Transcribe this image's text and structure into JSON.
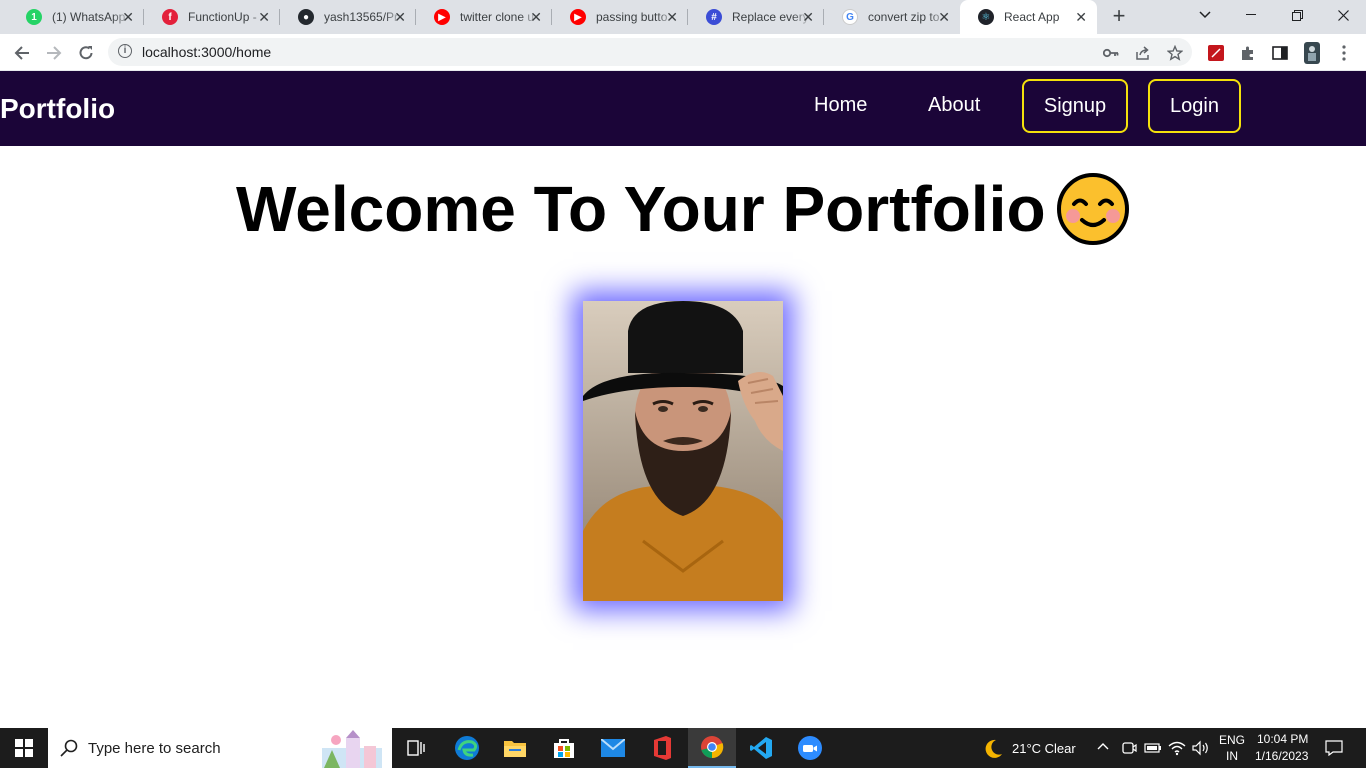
{
  "browser": {
    "tabs": [
      {
        "title": "(1) WhatsApp",
        "icon": "whatsapp-icon",
        "color": "#25d366",
        "glyph": "1"
      },
      {
        "title": "FunctionUp - ",
        "icon": "functionup-icon",
        "color": "#e3203b",
        "glyph": "f"
      },
      {
        "title": "yash13565/Pr",
        "icon": "github-icon",
        "color": "#24292f",
        "glyph": "●"
      },
      {
        "title": "twitter clone u",
        "icon": "youtube-icon",
        "color": "#ff0000",
        "glyph": "▶"
      },
      {
        "title": "passing butto",
        "icon": "youtube-icon",
        "color": "#ff0000",
        "glyph": "▶"
      },
      {
        "title": "Replace every",
        "icon": "geeks-icon",
        "color": "#3b4dd6",
        "glyph": "#"
      },
      {
        "title": "convert zip to",
        "icon": "google-icon",
        "color": "#4285f4",
        "glyph": "G"
      },
      {
        "title": "React App",
        "icon": "react-icon",
        "color": "#61dafb",
        "glyph": "⚛"
      }
    ],
    "url": "localhost:3000/home"
  },
  "page": {
    "brand": "Portfolio",
    "nav": {
      "home": "Home",
      "about": "About",
      "signup": "Signup",
      "login": "Login"
    },
    "heading": "Welcome To Your Portfolio",
    "accent": "#f4e10c",
    "navbar_color": "#1b0538",
    "glow_color": "#6f6bff"
  },
  "taskbar": {
    "search_placeholder": "Type here to search",
    "weather": "21°C  Clear",
    "lang_top": "ENG",
    "lang_bottom": "IN",
    "time": "10:04 PM",
    "date": "1/16/2023"
  }
}
